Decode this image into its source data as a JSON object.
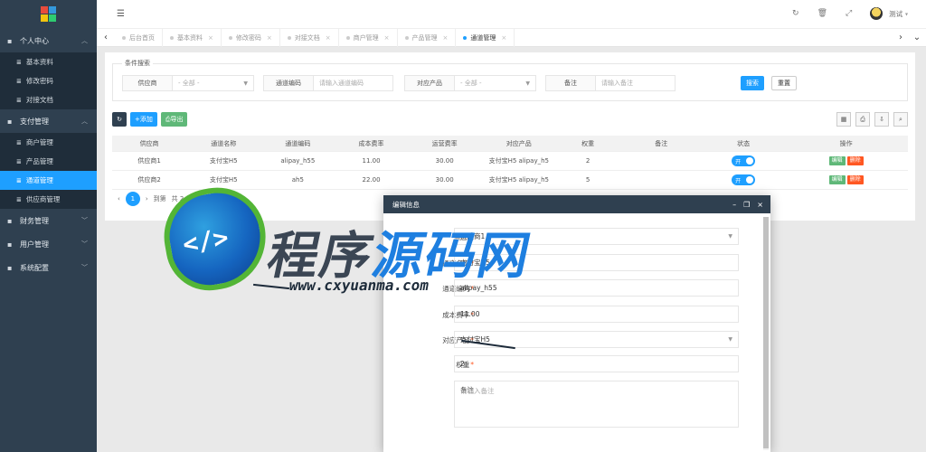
{
  "sidebar": {
    "groups": [
      {
        "label": "个人中心",
        "items": [
          "基本资料",
          "修改密码",
          "对接文档"
        ]
      },
      {
        "label": "支付管理",
        "items": [
          "商户管理",
          "产品管理",
          "通道管理",
          "供应商管理"
        ]
      },
      {
        "label": "财务管理",
        "items": []
      },
      {
        "label": "用户管理",
        "items": []
      },
      {
        "label": "系统配置",
        "items": []
      }
    ],
    "active_item": "通道管理"
  },
  "topbar": {
    "user_name": "测试"
  },
  "tabs": [
    {
      "label": "后台首页",
      "active": false
    },
    {
      "label": "基本资料",
      "active": false
    },
    {
      "label": "修改密码",
      "active": false
    },
    {
      "label": "对接文档",
      "active": false
    },
    {
      "label": "商户管理",
      "active": false
    },
    {
      "label": "产品管理",
      "active": false
    },
    {
      "label": "通道管理",
      "active": true
    }
  ],
  "filter": {
    "legend": "条件搜索",
    "fields": [
      {
        "label": "供应商",
        "value": "- 全部 -"
      },
      {
        "label": "通道编码",
        "value": "请输入通道编码"
      },
      {
        "label": "对应产品",
        "value": "- 全部 -"
      },
      {
        "label": "备注",
        "value": "请输入备注"
      }
    ],
    "search_label": "搜索",
    "reset_label": "重置"
  },
  "toolbar": {
    "add_label": "添加",
    "export_label": "导出"
  },
  "table": {
    "columns": [
      "供应商",
      "通道名称",
      "通道编码",
      "成本费率",
      "运营费率",
      "对应产品",
      "权重",
      "备注",
      "状态",
      "操作"
    ],
    "rows": [
      [
        "供应商1",
        "支付宝H5",
        "alipay_h55",
        "11.00",
        "30.00",
        "支付宝H5 alipay_h5",
        "2",
        "",
        "开",
        ""
      ],
      [
        "供应商2",
        "支付宝H5",
        "ah5",
        "22.00",
        "30.00",
        "支付宝H5 alipay_h5",
        "5",
        "",
        "开",
        ""
      ]
    ],
    "edit_label": "编辑",
    "delete_label": "删除"
  },
  "pager": {
    "current_page": "1",
    "goto": "到第",
    "total": "共 2 条",
    "page_size": "15 条/页"
  },
  "modal": {
    "title": "编辑信息",
    "fields": [
      {
        "label": "供应商",
        "required": false,
        "value": "供应商1",
        "select": true
      },
      {
        "label": "通道名称",
        "required": true,
        "value": "支付宝H5",
        "select": false
      },
      {
        "label": "通道编码",
        "required": true,
        "value": "alipay_h55",
        "select": false
      },
      {
        "label": "成本费率",
        "required": true,
        "value": "11.00",
        "select": false
      },
      {
        "label": "对应产品",
        "required": true,
        "value": "支付宝H5",
        "select": true
      },
      {
        "label": "权重",
        "required": true,
        "value": "2",
        "select": false
      },
      {
        "label": "备注",
        "required": false,
        "value": "请输入备注",
        "select": false
      }
    ]
  },
  "watermark": {
    "title_gray": "程序",
    "title_blue": "源码网",
    "url": "www.cxyuanma.com",
    "code": "</>"
  }
}
